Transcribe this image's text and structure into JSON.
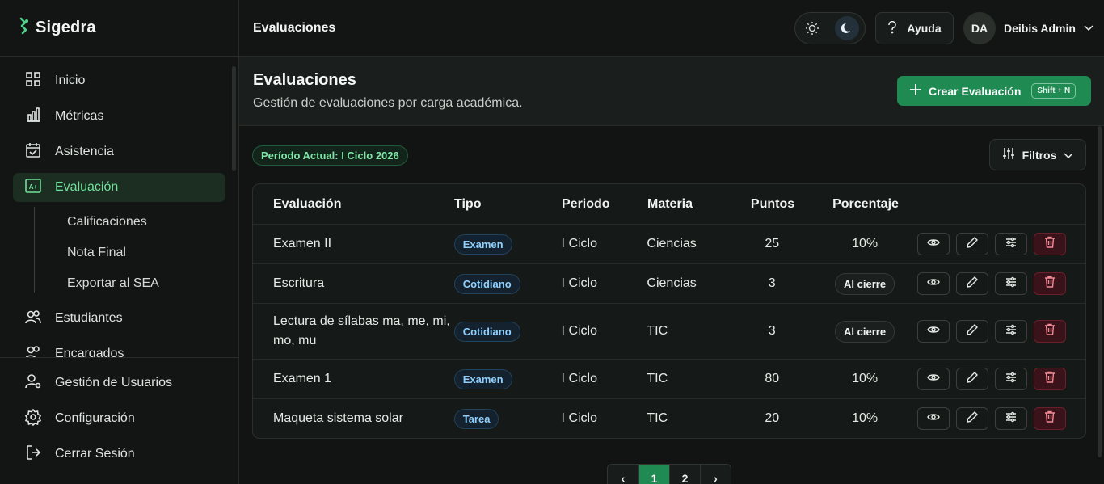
{
  "brand": {
    "name": "Sigedra",
    "accent": "#6fe39a"
  },
  "sidebar": {
    "items": [
      {
        "label": "Inicio",
        "icon": "grid-icon"
      },
      {
        "label": "Métricas",
        "icon": "bar-chart-icon"
      },
      {
        "label": "Asistencia",
        "icon": "calendar-check-icon"
      },
      {
        "label": "Evaluación",
        "icon": "grade-icon",
        "active": true
      }
    ],
    "subitems": [
      "Calificaciones",
      "Nota Final",
      "Exportar al SEA"
    ],
    "more_items": [
      {
        "label": "Estudiantes",
        "icon": "users-icon"
      },
      {
        "label": "Encargados",
        "icon": "users-icon"
      }
    ],
    "bottom_items": [
      {
        "label": "Gestión de Usuarios",
        "icon": "user-cog-icon"
      },
      {
        "label": "Configuración",
        "icon": "gear-icon"
      },
      {
        "label": "Cerrar Sesión",
        "icon": "logout-icon"
      }
    ]
  },
  "header": {
    "title": "Evaluaciones",
    "help_label": "Ayuda",
    "user": {
      "initials": "DA",
      "name": "Deibis Admin"
    }
  },
  "page": {
    "title": "Evaluaciones",
    "subtitle": "Gestión de evaluaciones por carga académica.",
    "create_label": "Crear Evaluación",
    "create_shortcut": "Shift + N",
    "period_badge": "Período Actual: I Ciclo 2026",
    "filters_label": "Filtros"
  },
  "table": {
    "columns": [
      "Evaluación",
      "Tipo",
      "Periodo",
      "Materia",
      "Puntos",
      "Porcentaje"
    ],
    "rows": [
      {
        "name": "Examen II",
        "tipo": "Examen",
        "periodo": "I Ciclo",
        "materia": "Ciencias",
        "puntos": "25",
        "porcentaje": "10%",
        "pct_badge": false
      },
      {
        "name": "Escritura",
        "tipo": "Cotidiano",
        "periodo": "I Ciclo",
        "materia": "Ciencias",
        "puntos": "3",
        "porcentaje": "Al cierre",
        "pct_badge": true
      },
      {
        "name": "Lectura de sílabas ma, me, mi, mo, mu",
        "tipo": "Cotidiano",
        "periodo": "I Ciclo",
        "materia": "TIC",
        "puntos": "3",
        "porcentaje": "Al cierre",
        "pct_badge": true
      },
      {
        "name": "Examen 1",
        "tipo": "Examen",
        "periodo": "I Ciclo",
        "materia": "TIC",
        "puntos": "80",
        "porcentaje": "10%",
        "pct_badge": false
      },
      {
        "name": "Maqueta sistema solar",
        "tipo": "Tarea",
        "periodo": "I Ciclo",
        "materia": "TIC",
        "puntos": "20",
        "porcentaje": "10%",
        "pct_badge": false
      }
    ],
    "actions": [
      "eye-icon",
      "pencil-icon",
      "sliders-icon",
      "trash-icon"
    ]
  },
  "pagination": {
    "prev": "‹",
    "pages": [
      "1",
      "2"
    ],
    "current": "1",
    "next": "›"
  }
}
